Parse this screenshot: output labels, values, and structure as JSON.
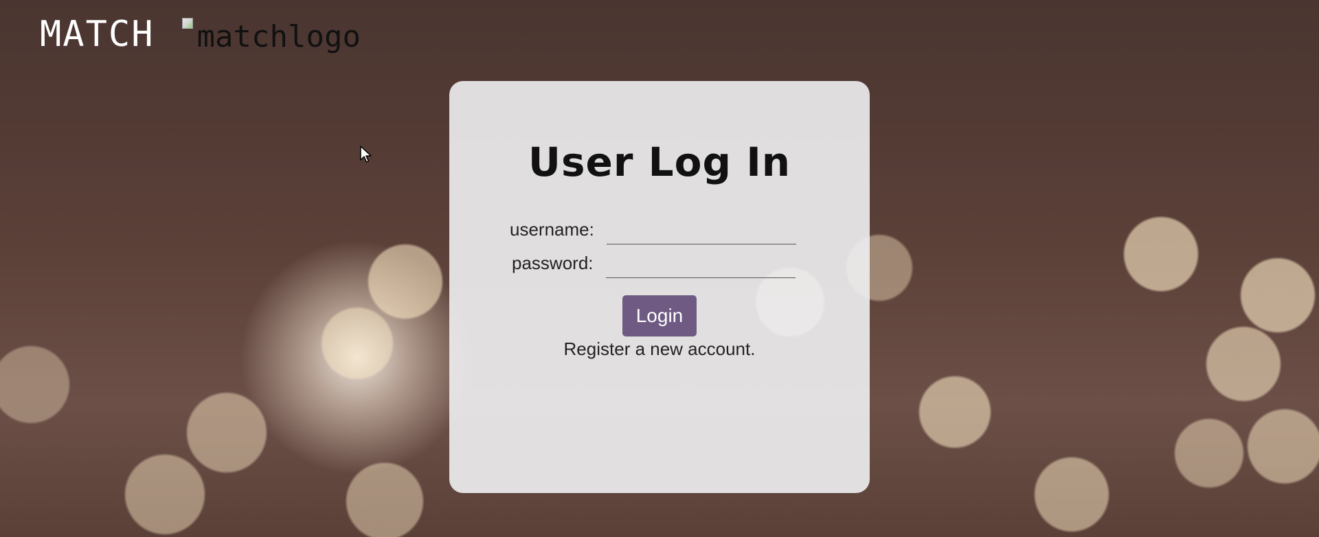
{
  "header": {
    "brand_title": "MATCH",
    "logo_alt": "matchlogo"
  },
  "login": {
    "title": "User Log In",
    "username_label": "username:",
    "username_value": "",
    "password_label": "password:",
    "password_value": "",
    "login_button": "Login",
    "register_link": "Register a new account."
  },
  "colors": {
    "button": "#6e5a82",
    "card": "#f0f0f2",
    "brand_text": "#ffffff"
  },
  "icons": [
    "broken-image-icon",
    "mouse-cursor-icon"
  ]
}
